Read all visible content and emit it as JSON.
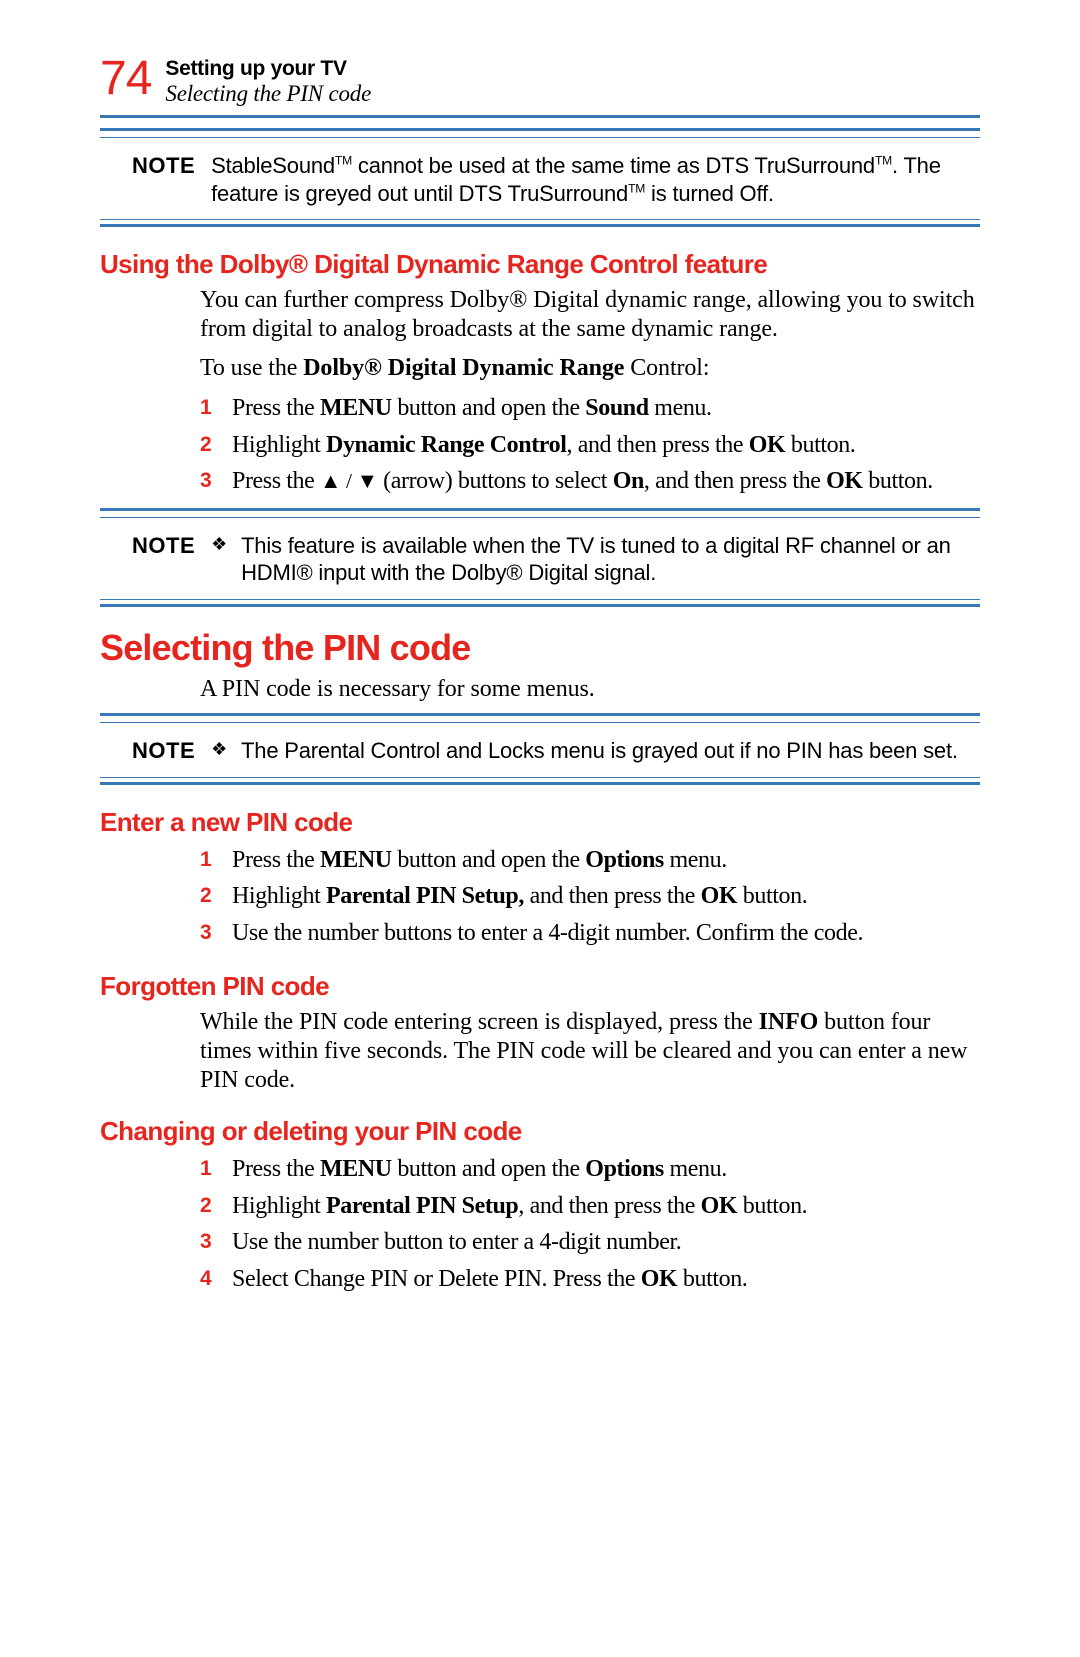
{
  "header": {
    "page_number": "74",
    "chapter": "Setting up your TV",
    "section": "Selecting the PIN code"
  },
  "note1": {
    "label": "NOTE",
    "text_pre": "StableSound",
    "tm1": "TM",
    "text_mid": " cannot be used at the same time as DTS TruSurround",
    "tm2": "TM",
    "text_mid2": ". The feature is greyed out until DTS TruSurround",
    "tm3": "TM",
    "text_end": " is turned Off."
  },
  "dolby": {
    "heading": "Using the Dolby® Digital Dynamic Range Control feature",
    "intro": "You can further compress Dolby® Digital dynamic range, allowing you to switch from digital to analog broadcasts at the same dynamic range.",
    "to_use_pre": "To use the ",
    "to_use_bold": "Dolby® Digital Dynamic Range",
    "to_use_post": " Control:",
    "steps": [
      {
        "n": "1",
        "pre": "Press the ",
        "b1": "MENU",
        "mid": " button and open the ",
        "b2": "Sound",
        "post": " menu."
      },
      {
        "n": "2",
        "pre": "Highlight ",
        "b1": "Dynamic Range Control",
        "mid": ", and then press the ",
        "b2": "OK",
        "post": " button."
      },
      {
        "n": "3",
        "pre": "Press the ",
        "arrows": "▲ / ▼",
        "mid1": " (arrow) buttons to select ",
        "b1": "On",
        "mid2": ", and then press the ",
        "b2": "OK",
        "post": " button."
      }
    ]
  },
  "note2": {
    "label": "NOTE",
    "bullet": "❖",
    "text": "This feature is available when the TV is tuned to a digital RF channel or an HDMI® input with the Dolby® Digital signal."
  },
  "pin": {
    "heading": "Selecting the PIN code",
    "intro": "A PIN code is necessary for some menus."
  },
  "note3": {
    "label": "NOTE",
    "bullet": "❖",
    "text": "The Parental Control and Locks menu is grayed out if no PIN has been set."
  },
  "enter": {
    "heading": "Enter a new PIN code",
    "steps": [
      {
        "n": "1",
        "pre": "Press the ",
        "b1": "MENU",
        "mid": " button and open the ",
        "b2": "Options",
        "post": " menu."
      },
      {
        "n": "2",
        "pre": "Highlight ",
        "b1": "Parental PIN Setup,",
        "mid": " and then press the ",
        "b2": "OK",
        "post": " button."
      },
      {
        "n": "3",
        "text": "Use the number buttons to enter a 4-digit number. Confirm the code."
      }
    ]
  },
  "forgot": {
    "heading": "Forgotten PIN code",
    "text_pre": "While the PIN code entering screen is displayed, press the ",
    "text_bold": "INFO",
    "text_post": " button four times within five seconds. The PIN code will be cleared and you can enter a new PIN code."
  },
  "change": {
    "heading": "Changing or deleting your PIN code",
    "steps": [
      {
        "n": "1",
        "pre": "Press the ",
        "b1": "MENU",
        "mid": " button and open the ",
        "b2": "Options",
        "post": " menu."
      },
      {
        "n": "2",
        "pre": "Highlight ",
        "b1": "Parental PIN Setup",
        "mid": ", and then press the ",
        "b2": "OK",
        "post": " button."
      },
      {
        "n": "3",
        "text": "Use the number button to enter a 4-digit number."
      },
      {
        "n": "4",
        "pre": "Select Change PIN or Delete PIN. Press the ",
        "b1": "OK",
        "post": " button."
      }
    ]
  }
}
